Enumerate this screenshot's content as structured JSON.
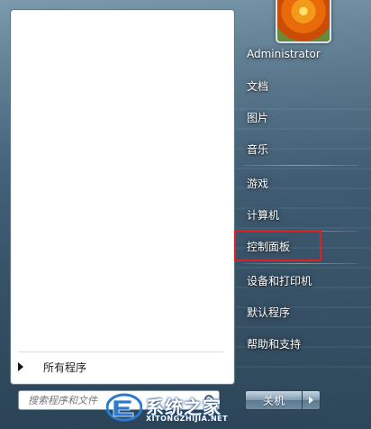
{
  "start_menu": {
    "user_name": "Administrator",
    "right_items": [
      {
        "label": "文档"
      },
      {
        "label": "图片"
      },
      {
        "label": "音乐"
      },
      {
        "label": "游戏"
      },
      {
        "label": "计算机"
      },
      {
        "label": "控制面板"
      },
      {
        "label": "设备和打印机"
      },
      {
        "label": "默认程序"
      },
      {
        "label": "帮助和支持"
      }
    ],
    "all_programs_label": "所有程序",
    "search_placeholder": "搜索程序和文件",
    "shutdown_label": "关机",
    "highlighted_item": "控制面板",
    "highlight_color": "#e02020"
  },
  "watermark": {
    "text": "系统之家",
    "url": "XITONGZHIJIA.NET"
  }
}
